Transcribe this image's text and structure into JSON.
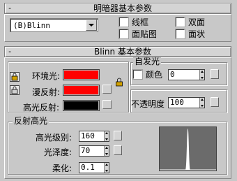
{
  "shader_rollout": {
    "title": "明暗器基本参数",
    "collapse_symbol": "-",
    "shader_dropdown": "(B)Blinn",
    "options": {
      "wire": "线框",
      "two_sided": "双面",
      "face_map": "面贴图",
      "faceted": "面状"
    }
  },
  "blinn_rollout": {
    "title": "Blinn 基本参数",
    "collapse_symbol": "-",
    "ambient_label": "环境光:",
    "diffuse_label": "漫反射:",
    "specular_label": "高光反射:",
    "ambient_color": "#ff0000",
    "diffuse_color": "#ff0000",
    "specular_color": "#000000",
    "self_illum": {
      "title": "自发光",
      "color_label": "颜色",
      "value": "0"
    },
    "opacity": {
      "label": "不透明度",
      "value": "100"
    },
    "specular_highlights": {
      "title": "反射高光",
      "level_label": "高光级别:",
      "level_value": "160",
      "gloss_label": "光泽度:",
      "gloss_value": "70",
      "soften_label": "柔化:",
      "soften_value": "0.1"
    }
  }
}
